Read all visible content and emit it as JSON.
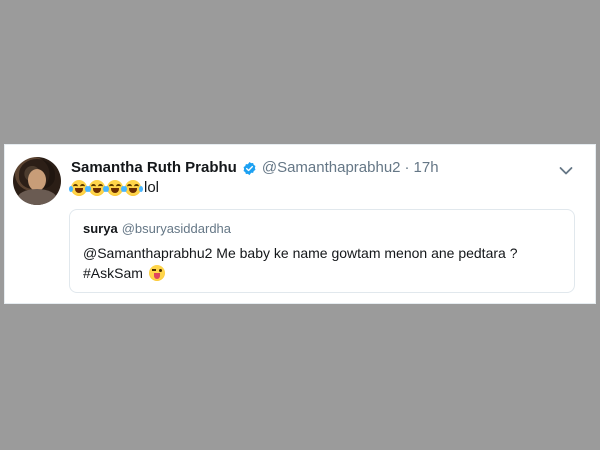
{
  "tweet": {
    "display_name": "Samantha Ruth Prabhu",
    "handle": "@Samanthaprabhu2",
    "separator": "·",
    "time": "17h",
    "emoji_count_joy": 4,
    "text_suffix": "lol",
    "verified_icon": "verified-check-icon",
    "menu_icon": "chevron-down-icon",
    "avatar_icon": "profile-photo"
  },
  "quoted_tweet": {
    "display_name": "surya",
    "handle": "@bsuryasiddardha",
    "line1": "@Samanthaprabhu2 Me baby ke name gowtam menon ane pedtara ?",
    "line2": "#AskSam",
    "emoji": "winking-face-with-tongue"
  },
  "colors": {
    "page_background": "#9b9b9b",
    "card_background": "#ffffff",
    "verified_blue": "#1da1f2",
    "secondary_text": "#657786",
    "primary_text": "#14171a"
  }
}
